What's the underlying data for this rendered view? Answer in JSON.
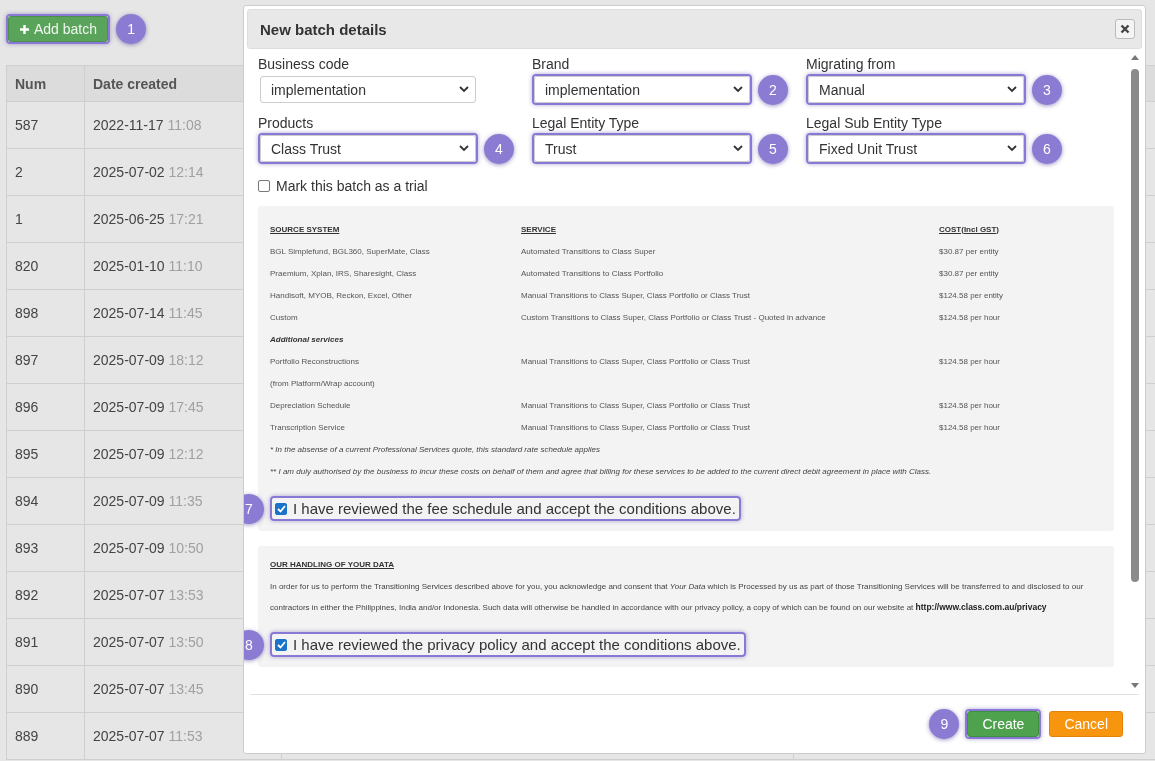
{
  "page": {
    "add_button": {
      "label": "Add batch",
      "highlighted": true,
      "badge": "1"
    },
    "table": {
      "columns": [
        "Num",
        "Date created"
      ],
      "rows": [
        {
          "num": "587",
          "date": "2022-11-17",
          "time": "11:08"
        },
        {
          "num": "2",
          "date": "2025-07-02",
          "time": "12:14"
        },
        {
          "num": "1",
          "date": "2025-06-25",
          "time": "17:21"
        },
        {
          "num": "820",
          "date": "2025-01-10",
          "time": "11:10"
        },
        {
          "num": "898",
          "date": "2025-07-14",
          "time": "11:45"
        },
        {
          "num": "897",
          "date": "2025-07-09",
          "time": "18:12"
        },
        {
          "num": "896",
          "date": "2025-07-09",
          "time": "17:45"
        },
        {
          "num": "895",
          "date": "2025-07-09",
          "time": "12:12"
        },
        {
          "num": "894",
          "date": "2025-07-09",
          "time": "11:35"
        },
        {
          "num": "893",
          "date": "2025-07-09",
          "time": "10:50"
        },
        {
          "num": "892",
          "date": "2025-07-07",
          "time": "13:53"
        },
        {
          "num": "891",
          "date": "2025-07-07",
          "time": "13:50"
        },
        {
          "num": "890",
          "date": "2025-07-07",
          "time": "13:45"
        },
        {
          "num": "889",
          "date": "2025-07-07",
          "time": "11:53"
        }
      ]
    }
  },
  "dialog": {
    "title": "New batch details",
    "fields": [
      {
        "label": "Business code",
        "value": "implementation",
        "highlighted": false
      },
      {
        "label": "Brand",
        "value": "implementation",
        "highlighted": true,
        "badge": "2"
      },
      {
        "label": "Migrating from",
        "value": "Manual",
        "highlighted": true,
        "badge": "3"
      },
      {
        "label": "Products",
        "value": "Class Trust",
        "highlighted": true,
        "badge": "4"
      },
      {
        "label": "Legal Entity Type",
        "value": "Trust",
        "highlighted": true,
        "badge": "5"
      },
      {
        "label": "Legal Sub Entity Type",
        "value": "Fixed Unit Trust",
        "highlighted": true,
        "badge": "6"
      }
    ],
    "trial_checkbox": {
      "label": "Mark this batch as a trial",
      "checked": false
    },
    "fee_schedule": {
      "columns": [
        "SOURCE SYSTEM",
        "SERVICE",
        "COST(Incl GST)"
      ],
      "rows": [
        {
          "kind": "row",
          "cells": [
            "BGL Simplefund, BGL360, SuperMate, Class",
            "Automated Transitions to Class Super",
            "$30.87 per entity"
          ]
        },
        {
          "kind": "row",
          "cells": [
            "Praemium, Xplan, IRS, Sharesight, Class",
            "Automated Transitions to Class Portfolio",
            "$30.87 per entity"
          ]
        },
        {
          "kind": "row",
          "cells": [
            "Handisoft, MYOB, Reckon, Excel, Other",
            "Manual Transitions to Class Super, Class Portfolio or Class Trust",
            "$124.58 per entity"
          ]
        },
        {
          "kind": "row",
          "cells": [
            "Custom",
            "Custom Transitions to Class Super, Class Portfolio or Class Trust - Quoted in advance",
            "$124.58 per hour"
          ]
        },
        {
          "kind": "section",
          "text": "Additional services"
        },
        {
          "kind": "row",
          "cells": [
            "Portfolio Reconstructions",
            "Manual Transitions to Class Super, Class Portfolio or Class Trust",
            "$124.58 per hour"
          ]
        },
        {
          "kind": "row",
          "cells": [
            "(from Platform/Wrap account)"
          ]
        },
        {
          "kind": "row",
          "cells": [
            "Depreciation Schedule",
            "Manual Transitions to Class Super, Class Portfolio or Class Trust",
            "$124.58 per hour"
          ]
        },
        {
          "kind": "row",
          "cells": [
            "Transcription Service",
            "Manual Transitions to Class Super, Class Portfolio or Class Trust",
            "$124.58 per hour"
          ]
        },
        {
          "kind": "note",
          "text": "* In the absense of a current Professional Services quote, this standard rate schedule applies"
        },
        {
          "kind": "note",
          "text": "** I am duly authorised by the business to incur these costs on behalf of them and agree that billing for these services to be added to the current direct debit agreement in place with Class."
        }
      ],
      "accept": {
        "label": "I have reviewed the fee schedule and accept the conditions above.",
        "checked": true,
        "highlighted": true,
        "badge": "7"
      }
    },
    "privacy": {
      "heading": "OUR HANDLING OF YOUR DATA",
      "text": "In order for us to perform the Transitioning Services described above for you, you acknowledge and consent that *Your Data* which is Processed by us as part of those Transitioning Services will be transferred to and disclosed to our contractors in either the Philippines, India and/or Indonesia. Such data will otherwise be handled in accordance with our privacy policy, a copy of which can be found on our website at",
      "link": "http://www.class.com.au/privacy",
      "accept": {
        "label": "I have reviewed the privacy policy and accept the conditions above.",
        "checked": true,
        "highlighted": true,
        "badge": "8"
      }
    },
    "buttons": [
      {
        "label": "Create",
        "kind": "primary",
        "highlighted": true,
        "badge": "9"
      },
      {
        "label": "Cancel",
        "kind": "cancel",
        "highlighted": false
      }
    ]
  }
}
